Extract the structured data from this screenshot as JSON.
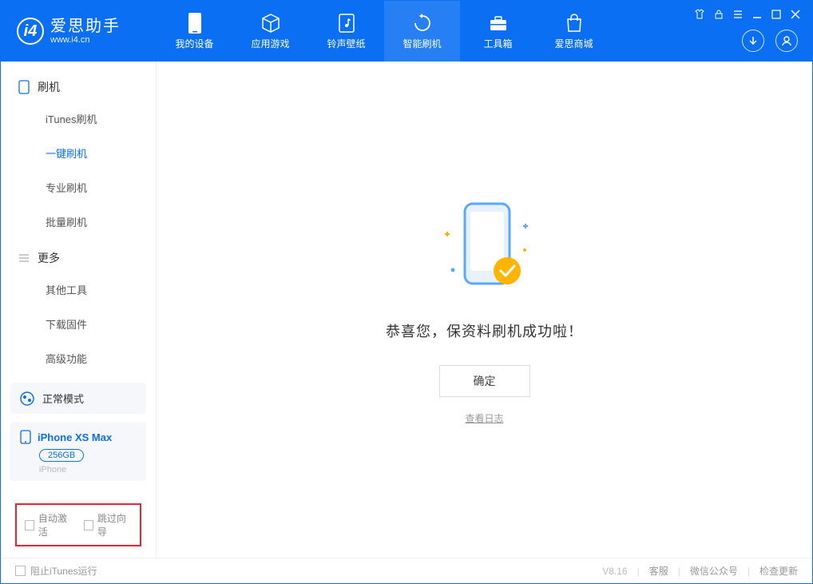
{
  "app": {
    "title": "爱思助手",
    "url": "www.i4.cn"
  },
  "nav": [
    {
      "label": "我的设备"
    },
    {
      "label": "应用游戏"
    },
    {
      "label": "铃声壁纸"
    },
    {
      "label": "智能刷机"
    },
    {
      "label": "工具箱"
    },
    {
      "label": "爱思商城"
    }
  ],
  "sidebar": {
    "section1": {
      "title": "刷机",
      "items": [
        "iTunes刷机",
        "一键刷机",
        "专业刷机",
        "批量刷机"
      ]
    },
    "section2": {
      "title": "更多",
      "items": [
        "其他工具",
        "下载固件",
        "高级功能"
      ]
    }
  },
  "status": {
    "mode": "正常模式"
  },
  "device": {
    "name": "iPhone XS Max",
    "capacity": "256GB",
    "type": "iPhone"
  },
  "options": {
    "auto_activate": "自动激活",
    "skip_guide": "跳过向导"
  },
  "main": {
    "success": "恭喜您，保资料刷机成功啦！",
    "ok": "确定",
    "view_log": "查看日志"
  },
  "footer": {
    "block_itunes": "阻止iTunes运行",
    "version": "V8.16",
    "kefu": "客服",
    "wechat": "微信公众号",
    "update": "检查更新"
  }
}
